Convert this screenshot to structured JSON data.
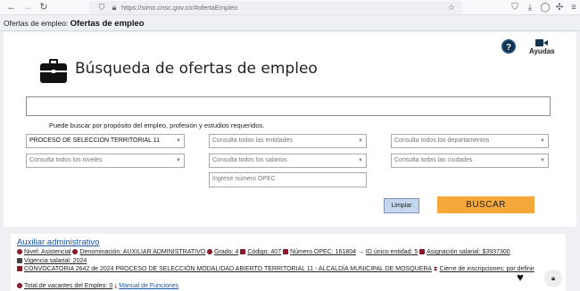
{
  "browser": {
    "url_host": "https://simo.cnsc.gov.co",
    "url_path": "/#ofertaEmpleo"
  },
  "breadcrumb": {
    "label": "Ofertas de empleo:",
    "current": "Ofertas de empleo"
  },
  "help": {
    "question_glyph": "?",
    "ayudas_label": "Ayudas"
  },
  "search": {
    "title": "Búsqueda de ofertas de empleo",
    "help_text": "Puede buscar por propósito del empleo, profesión y estudios requeridos.",
    "filters": {
      "proceso": "PROCESO DE SELECCIÓN TERRITORIAL 11",
      "entidades": "Consulta todas las entidades",
      "departamentos": "Consulta todos los departamentos",
      "niveles": "Consulta todos los niveles",
      "salarios": "Consulta todos los salarios",
      "ciudades": "Consulta todas las ciudades",
      "opec_placeholder": "Ingrese número OPEC"
    },
    "clear_label": "Limpiar",
    "search_label": "BUSCAR"
  },
  "result": {
    "title": "Auxiliar administrativo",
    "nivel": "Nivel: Asistencial",
    "denominacion": "Denominación: AUXILIAR ADMINISTRATIVO",
    "grado": "Grado: 4",
    "codigo": "Código: 407",
    "opec": "Número OPEC: 161804",
    "id_entidad": "ID único entidad: 5",
    "asignacion": "Asignación salarial: $3937300",
    "vigencia": "Vigencia salarial: 2024",
    "convocatoria": "CONVOCATORIA 2642 de 2024 PROCESO DE SELECCIÓN MODALIDAD ABIERTO TERRITORIAL 11 - ALCALDÍA MUNICIPAL DE MOSQUERA",
    "cierre": "Cierre de inscripciones: por definir",
    "vacantes": "Total de vacantes del Empleo: 0",
    "manual": "Manual de Funciones"
  }
}
